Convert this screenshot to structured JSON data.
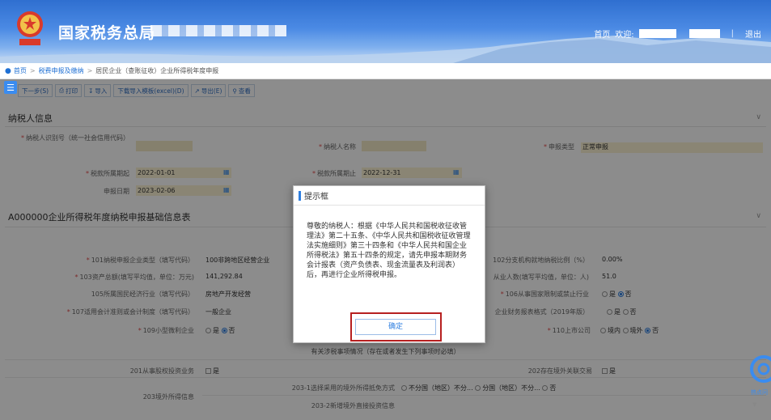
{
  "header": {
    "brand": "国家税务总局",
    "home": "首页",
    "welcome": "欢迎:",
    "logout": "退出"
  },
  "breadcrumb": {
    "home": "首页",
    "level1": "税费申报及缴纳",
    "level2": "居民企业（查账征收）企业所得税年度申报"
  },
  "toolbar": {
    "buttons": [
      {
        "label": "下一步(S)",
        "icon": "arrow-right-icon"
      },
      {
        "label": "打印",
        "icon": "printer-icon"
      },
      {
        "label": "导入",
        "icon": "import-icon"
      },
      {
        "label": "下载导入模板(excel)(D)",
        "icon": ""
      },
      {
        "label": "导出(E)",
        "icon": "export-icon"
      },
      {
        "label": "查看",
        "icon": "search-icon"
      }
    ]
  },
  "taxpayer": {
    "title": "纳税人信息",
    "tin_label": "纳税人识别号（统一社会信用代码）",
    "name_label": "纳税人名称",
    "declare_type_label": "申报类型",
    "declare_type_value": "正常申报",
    "period_start_label": "税款所属期起",
    "period_start_value": "2022-01-01",
    "period_end_label": "税款所属期止",
    "period_end_value": "2022-12-31",
    "declare_date_label": "申报日期",
    "declare_date_value": "2023-02-06"
  },
  "basic": {
    "title": "A000000企业所得税年度纳税申报基础信息表",
    "r101_label": "101纳税申报企业类型（填写代码）",
    "r101_value": "100非跨地区经营企业",
    "r102_label": "102分支机构就地纳税比例（%）",
    "r102_value": "0.00%",
    "r103_label": "103资产总额(填写平均值，单位：万元)",
    "r103_value": "141,292.84",
    "r104_label": "从业人数(填写平均值，单位：人)",
    "r104_value": "51.0",
    "r105_label": "105所属国民经济行业（填写代码）",
    "r105_value": "房地产开发经营",
    "r106_label": "106从事国家限制或禁止行业",
    "r106_opt1": "是",
    "r106_opt2": "否",
    "r107_label": "107适用会计准则或会计制度（填写代码）",
    "r107_value": "一般企业",
    "r108_label": "企业财务报表格式（2019年版）",
    "r108_opt1": "是",
    "r108_opt2": "否",
    "r109_label": "109小型微利企业",
    "r109_opt1": "是",
    "r109_opt2": "否",
    "r110_label": "110上市公司",
    "r110_opt1": "境内",
    "r110_opt2": "境外",
    "r110_opt3": "否",
    "sub_title": "有关涉税事项情况（存在或者发生下列事项时必填）",
    "r201_label": "201从事股权投资业务",
    "r201_opt": "是",
    "r202_label": "202存在境外关联交易",
    "r202_opt": "是",
    "r203_label": "203境外所得信息",
    "r2031_label": "203-1选择采用的境外所得抵免方式",
    "r2031_opt1": "不分国（地区）不分...",
    "r2031_opt2": "分国（地区）不分...",
    "r2031_opt3": "否",
    "r2032_label": "203-2新增境外直接投资信息"
  },
  "dialog": {
    "title": "提示框",
    "message": "尊敬的纳税人：根据《中华人民共和国税收征收管理法》第二十五条、《中华人民共和国税收征收管理法实施细则》第三十四条和《中华人民共和国企业所得税法》第五十四条的规定，请先申报本期财务会计报表（资产负债表、现金流量表及利润表）后，再进行企业所得税申报。",
    "ok": "确定"
  },
  "widget": {
    "label": "热点问"
  }
}
